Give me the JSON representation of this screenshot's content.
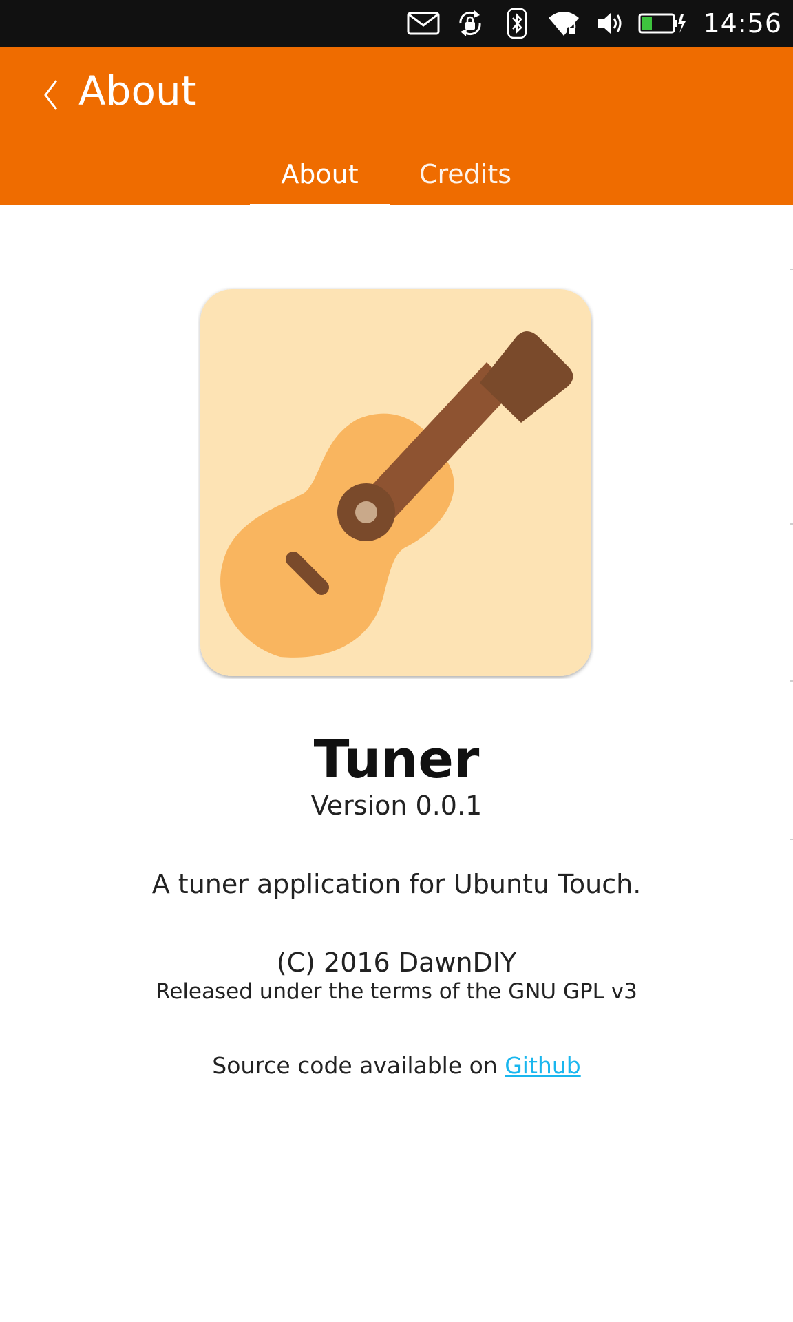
{
  "status_bar": {
    "icons": [
      "mail-icon",
      "rotation-lock-icon",
      "bluetooth-icon",
      "wifi-icon",
      "volume-icon",
      "battery-charging-icon"
    ],
    "time": "14:56"
  },
  "header": {
    "title": "About",
    "tabs": [
      {
        "label": "About",
        "selected": true
      },
      {
        "label": "Credits",
        "selected": false
      }
    ],
    "color": "#ef6c00"
  },
  "about": {
    "app_name": "Tuner",
    "version": "Version 0.0.1",
    "description": "A tuner application for Ubuntu Touch.",
    "copyright": "(C) 2016 DawnDIY",
    "license": "Released under the terms of the GNU GPL v3",
    "source_prefix": "Source code available on ",
    "source_link": "Github",
    "link_color": "#19b6ee"
  }
}
